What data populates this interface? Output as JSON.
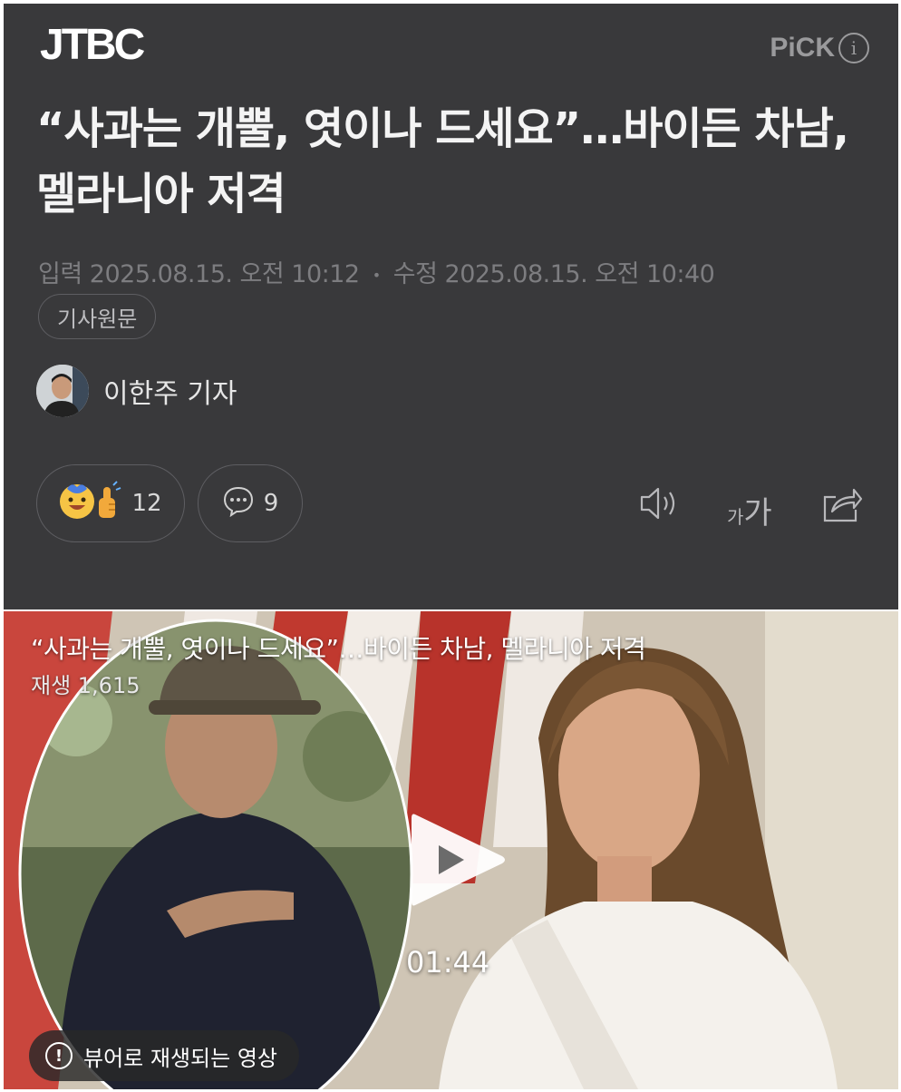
{
  "header": {
    "logo": "JTBC",
    "pick_label": "PiCK",
    "pick_info_icon": "info-icon"
  },
  "article": {
    "headline": "“사과는 개뿔, 엿이나 드세요”…바이든 차남, 멜라니아 저격",
    "published_label": "입력",
    "published": "2025.08.15. 오전 10:12",
    "modified_label": "수정",
    "modified": "2025.08.15. 오전 10:40",
    "original_button": "기사원문",
    "reporter": "이한주 기자"
  },
  "actions": {
    "reaction_count": "12",
    "comment_count": "9",
    "font_small": "가",
    "font_large": "가",
    "icons": [
      "reaction-emoji-icon",
      "comment-icon",
      "speaker-icon",
      "font-size-icon",
      "share-icon"
    ]
  },
  "video": {
    "title": "“사과는 개뿔, 엿이나 드세요”…바이든 차남, 멜라니아 저격",
    "views": "재생 1,615",
    "duration": "01:44",
    "viewer_notice": "뷰어로 재생되는 영상"
  },
  "colors": {
    "panel_bg": "#39393b",
    "text_primary": "#f4f4f4",
    "text_muted": "#7d7d80"
  }
}
